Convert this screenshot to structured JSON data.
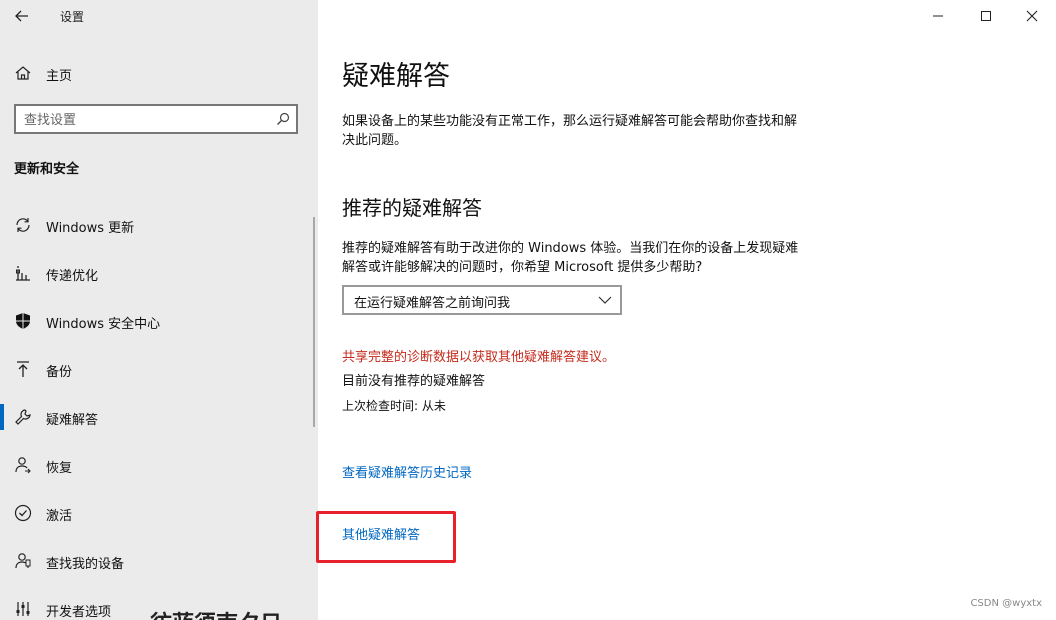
{
  "window": {
    "app_title": "设置",
    "minimize_label": "minimize",
    "maximize_label": "maximize",
    "close_label": "close"
  },
  "sidebar": {
    "home_label": "主页",
    "search_placeholder": "查找设置",
    "section_title": "更新和安全",
    "items": [
      {
        "label": "Windows 更新",
        "icon": "sync-icon"
      },
      {
        "label": "传递优化",
        "icon": "delivery-optimization-icon"
      },
      {
        "label": "Windows 安全中心",
        "icon": "shield-icon"
      },
      {
        "label": "备份",
        "icon": "backup-arrow-icon"
      },
      {
        "label": "疑难解答",
        "icon": "wrench-icon",
        "active": true
      },
      {
        "label": "恢复",
        "icon": "recovery-person-icon"
      },
      {
        "label": "激活",
        "icon": "check-circle-icon"
      },
      {
        "label": "查找我的设备",
        "icon": "find-device-person-icon"
      },
      {
        "label": "开发者选项",
        "icon": "developer-sliders-icon"
      }
    ],
    "bottom_fragment": "彷蓝须南夕日"
  },
  "main": {
    "title": "疑难解答",
    "description": "如果设备上的某些功能没有正常工作，那么运行疑难解答可能会帮助你查找和解决此问题。",
    "recommended_heading": "推荐的疑难解答",
    "recommended_description": "推荐的疑难解答有助于改进你的 Windows 体验。当我们在你的设备上发现疑难解答或许能够解决的问题时，你希望 Microsoft 提供多少帮助?",
    "dropdown_value": "在运行疑难解答之前询问我",
    "warning": "共享完整的诊断数据以获取其他疑难解答建议。",
    "no_recommended": "目前没有推荐的疑难解答",
    "last_check": "上次检查时间: 从未",
    "history_link": "查看疑难解答历史记录",
    "other_link": "其他疑难解答"
  },
  "watermark": "CSDN @wyxtx",
  "colors": {
    "accent": "#0067c0",
    "warning": "#c42b1c",
    "highlight": "#e8202a",
    "sidebar_bg": "#ebebeb"
  }
}
